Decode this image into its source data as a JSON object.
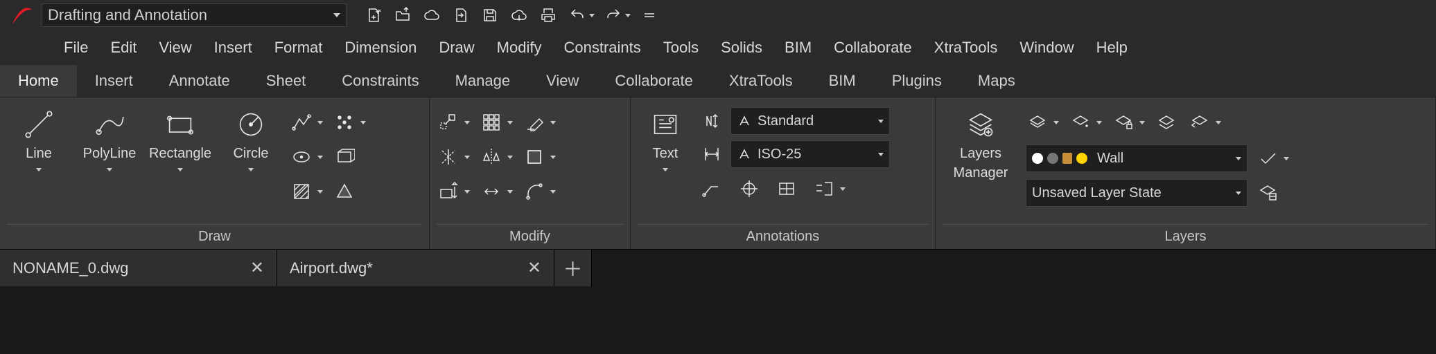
{
  "workspace": {
    "current": "Drafting and Annotation"
  },
  "menu": [
    "File",
    "Edit",
    "View",
    "Insert",
    "Format",
    "Dimension",
    "Draw",
    "Modify",
    "Constraints",
    "Tools",
    "Solids",
    "BIM",
    "Collaborate",
    "XtraTools",
    "Window",
    "Help"
  ],
  "ribbon_tabs": [
    "Home",
    "Insert",
    "Annotate",
    "Sheet",
    "Constraints",
    "Manage",
    "View",
    "Collaborate",
    "XtraTools",
    "BIM",
    "Plugins",
    "Maps"
  ],
  "ribbon_active_index": 0,
  "panels": {
    "draw": {
      "title": "Draw",
      "big": [
        {
          "name": "line",
          "label": "Line"
        },
        {
          "name": "polyline",
          "label": "PolyLine"
        },
        {
          "name": "rectangle",
          "label": "Rectangle"
        },
        {
          "name": "circle",
          "label": "Circle"
        }
      ],
      "small": [
        "polyline3d",
        "point-array",
        "ellipse",
        "region",
        "hatch",
        "polygon"
      ]
    },
    "modify": {
      "title": "Modify",
      "small": [
        "move",
        "pattern",
        "erase",
        "trim",
        "mirror",
        "fillet",
        "offset",
        "stretch",
        "chamfer"
      ]
    },
    "annotations": {
      "title": "Annotations",
      "text_button": "Text",
      "text_style": "Standard",
      "dim_style": "ISO-25",
      "row_icons": [
        "leader",
        "annoscale",
        "table",
        "multileader-style"
      ]
    },
    "layers": {
      "title": "Layers",
      "manager_button_line1": "Layers",
      "manager_button_line2": "Manager",
      "current_layer": "Wall",
      "layer_state": "Unsaved Layer State",
      "toprow_icons": [
        "layer-isolate",
        "layer-new",
        "layer-lock",
        "layer-match",
        "layer-previous"
      ]
    }
  },
  "doc_tabs": [
    {
      "name": "NONAME_0.dwg",
      "dirty": false
    },
    {
      "name": "Airport.dwg*",
      "dirty": true
    }
  ]
}
